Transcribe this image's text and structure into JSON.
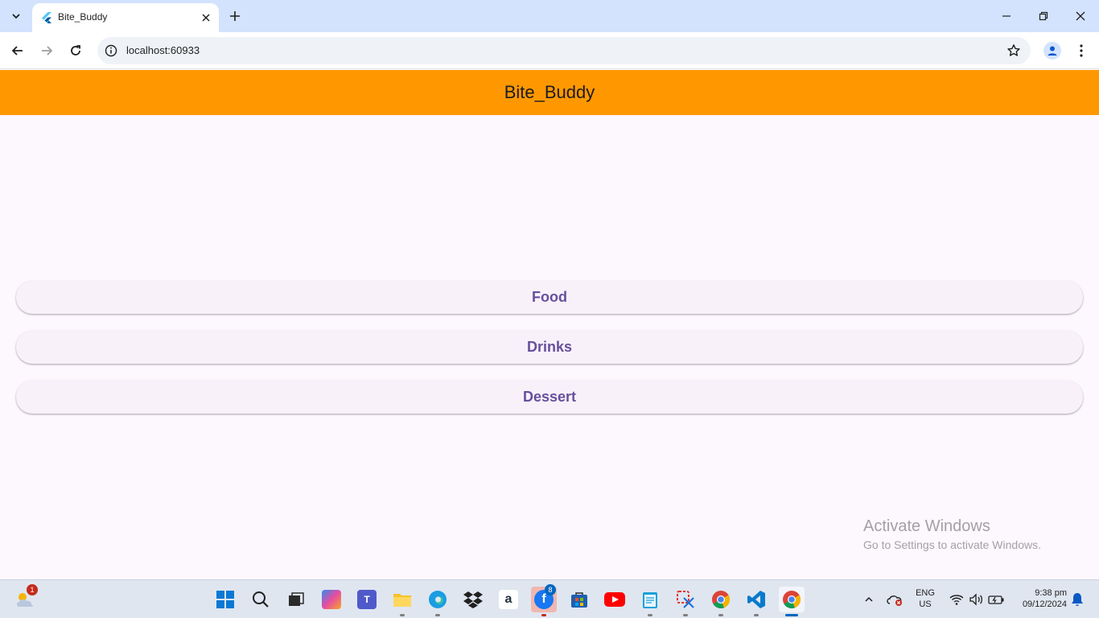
{
  "browser": {
    "tab_title": "Bite_Buddy",
    "url": "localhost:60933"
  },
  "app": {
    "title": "Bite_Buddy",
    "colors": {
      "appbar": "#ff9800",
      "button_text": "#65509c",
      "background": "#fdf7fe"
    },
    "buttons": [
      {
        "label": "Food"
      },
      {
        "label": "Drinks"
      },
      {
        "label": "Dessert"
      }
    ]
  },
  "watermark": {
    "title": "Activate Windows",
    "subtitle": "Go to Settings to activate Windows."
  },
  "taskbar": {
    "weather_badge": "1",
    "facebook_badge": "8",
    "language_line1": "ENG",
    "language_line2": "US",
    "time": "9:38 pm",
    "date": "09/12/2024"
  }
}
